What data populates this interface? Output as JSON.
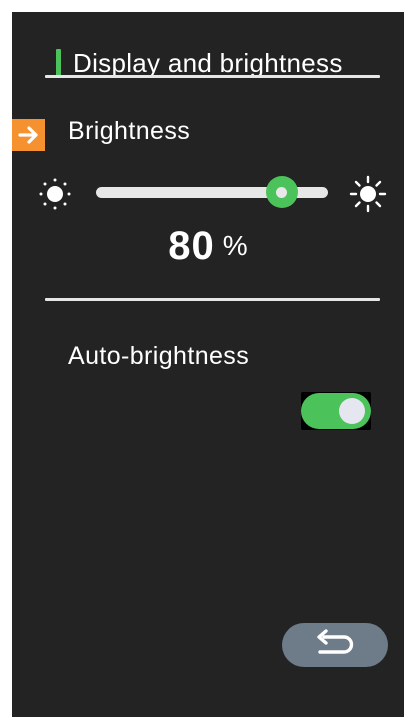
{
  "header": {
    "title": "Display and brightness",
    "accent_color": "#4cc25a"
  },
  "brightness": {
    "label": "Brightness",
    "value": "80",
    "unit": "%",
    "level": 0.8,
    "focus_color": "#f5922f",
    "icon_low": "sun-dim-icon",
    "icon_high": "sun-bright-icon"
  },
  "auto_brightness": {
    "label": "Auto-brightness",
    "enabled": true,
    "on_color": "#4cc25a"
  },
  "footer": {
    "back_icon": "return-arrow-icon",
    "button_color": "#6e7b88"
  }
}
